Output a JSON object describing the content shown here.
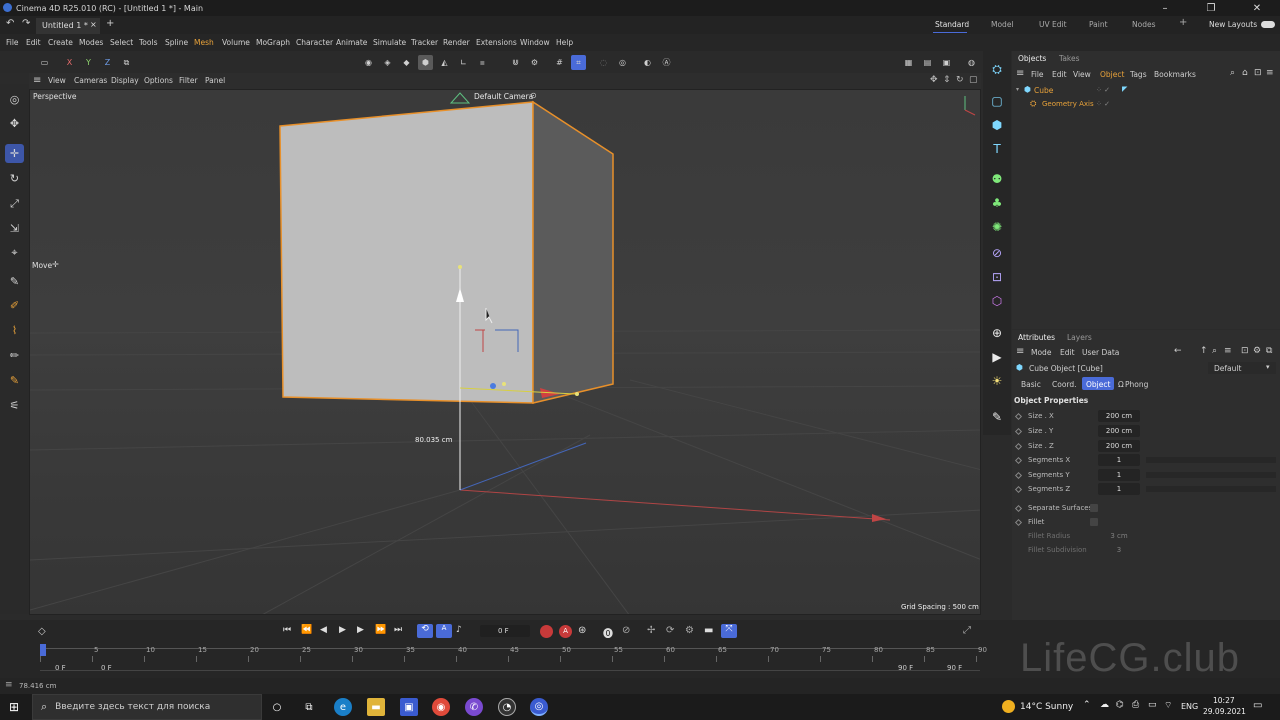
{
  "window": {
    "title": "Cinema 4D R25.010 (RC) - [Untitled 1 *] - Main",
    "minimize": "–",
    "maximize": "❐",
    "close": "✕"
  },
  "tabs": {
    "doc_tab": "Untitled 1 *",
    "doc_close": "×",
    "add": "+"
  },
  "layouts": [
    "Standard",
    "Model",
    "UV Edit",
    "Paint",
    "Nodes"
  ],
  "layout_add": "+",
  "new_layouts": "New Layouts",
  "menu": [
    "File",
    "Edit",
    "Create",
    "Modes",
    "Select",
    "Tools",
    "Spline",
    "Mesh",
    "Volume",
    "MoGraph",
    "Character",
    "Animate",
    "Simulate",
    "Tracker",
    "Render",
    "Extensions",
    "Window",
    "Help"
  ],
  "axis_lock": [
    "X",
    "Y",
    "Z"
  ],
  "viewport_menu": [
    "View",
    "Cameras",
    "Display",
    "Options",
    "Filter",
    "Panel"
  ],
  "viewport": {
    "label": "Perspective",
    "camera_label": "Default Camera",
    "camera_icon": "⊙",
    "tool_label": "Move",
    "tool_icon": "✛",
    "measure": "80.035 cm",
    "grid_spacing": "Grid Spacing : 500 cm"
  },
  "objects_panel": {
    "tabs": [
      "Objects",
      "Takes"
    ],
    "menu": [
      "File",
      "Edit",
      "View",
      "Object",
      "Tags",
      "Bookmarks"
    ],
    "items": [
      {
        "name": "Cube",
        "color": "#e8a23a"
      },
      {
        "name": "Geometry Axis",
        "color": "#e8a23a"
      }
    ]
  },
  "attributes_panel": {
    "tabs": [
      "Attributes",
      "Layers"
    ],
    "menu": [
      "Mode",
      "Edit",
      "User Data"
    ],
    "object_title": "Cube Object [Cube]",
    "preset": "Default",
    "subtabs": [
      "Basic",
      "Coord.",
      "Object",
      "Phong"
    ],
    "phong_icon": "Ω",
    "section": "Object Properties",
    "properties": [
      {
        "label": "Size . X",
        "value": "200 cm"
      },
      {
        "label": "Size . Y",
        "value": "200 cm"
      },
      {
        "label": "Size . Z",
        "value": "200 cm"
      },
      {
        "label": "Segments X",
        "value": "1"
      },
      {
        "label": "Segments Y",
        "value": "1"
      },
      {
        "label": "Segments Z",
        "value": "1"
      }
    ],
    "checks": [
      "Separate Surfaces",
      "Fillet"
    ],
    "disabled": [
      {
        "label": "Fillet Radius",
        "value": "3 cm"
      },
      {
        "label": "Fillet Subdivision",
        "value": "3"
      }
    ]
  },
  "timeline": {
    "current_frame": "0 F",
    "ticks": [
      "0",
      "5",
      "10",
      "15",
      "20",
      "25",
      "30",
      "35",
      "40",
      "45",
      "50",
      "55",
      "60",
      "65",
      "70",
      "75",
      "80",
      "85",
      "90"
    ],
    "start": "0 F",
    "start2": "0 F",
    "end": "90 F",
    "end2": "90 F"
  },
  "status": {
    "text": "78.416 cm"
  },
  "taskbar": {
    "search_placeholder": "Введите здесь текст для поиска",
    "weather": "14°C  Sunny",
    "lang": "ENG",
    "time": "10:27",
    "date": "29.09.2021"
  },
  "watermark": "LifeCG.club",
  "colors": {
    "accent": "#4a6bd8",
    "selection": "#e8a23a",
    "icon_blue": "#7fd8ff"
  }
}
